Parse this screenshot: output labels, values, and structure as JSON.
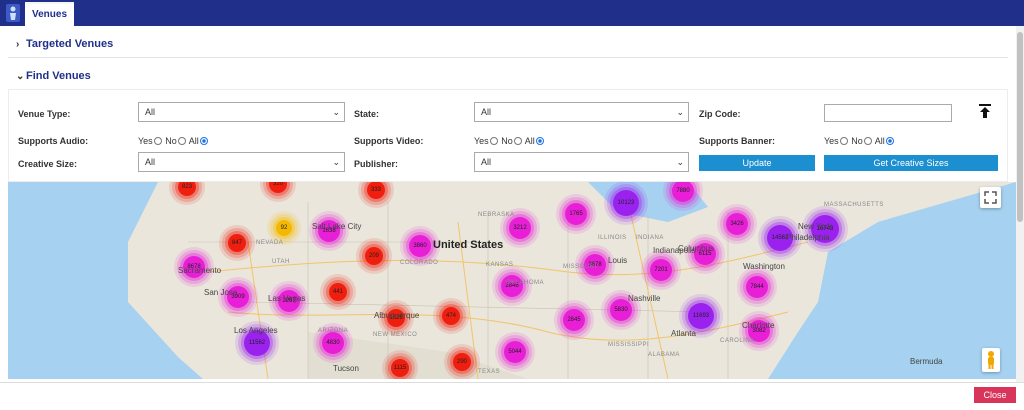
{
  "tab": {
    "label": "Venues"
  },
  "sections": {
    "targeted": "Targeted Venues",
    "find": "Find Venues"
  },
  "form": {
    "venue_type": {
      "label": "Venue Type:",
      "value": "All"
    },
    "state": {
      "label": "State:",
      "value": "All"
    },
    "zip": {
      "label": "Zip Code:",
      "value": ""
    },
    "audio": {
      "label": "Supports Audio:"
    },
    "video": {
      "label": "Supports Video:"
    },
    "banner": {
      "label": "Supports Banner:"
    },
    "radio_options": {
      "yes": "Yes",
      "no": "No",
      "all": "All"
    },
    "creative_size": {
      "label": "Creative Size:",
      "value": "All"
    },
    "publisher": {
      "label": "Publisher:",
      "value": "All"
    },
    "update_label": "Update",
    "get_sizes_label": "Get Creative Sizes"
  },
  "map": {
    "country": "United States",
    "states": [
      "NEBRASKA",
      "NEVADA",
      "UTAH",
      "COLORADO",
      "KANSAS",
      "MISSOURI",
      "ILLINOIS",
      "INDIANA",
      "OKLAHOMA",
      "NEW MEXICO",
      "ARIZONA",
      "TEXAS",
      "MISSISSIPPI",
      "ALABAMA",
      "CAROLINA",
      "MASSACHUSETTS"
    ],
    "cities": [
      "Sacramento",
      "San Jose",
      "Los Angeles",
      "Las Vegas",
      "Salt Lake City",
      "Albuquerque",
      "Tucson",
      "Nashville",
      "Atlanta",
      "Louis",
      "Indianapolis",
      "Columbus",
      "Washington",
      "New York",
      "Philadelphia",
      "Charlotte",
      "Bermuda"
    ],
    "clusters": [
      {
        "label": "823",
        "tone": "red"
      },
      {
        "label": "320",
        "tone": "red"
      },
      {
        "label": "333",
        "tone": "red"
      },
      {
        "label": "92",
        "tone": "yellow"
      },
      {
        "label": "1638",
        "tone": "magenta"
      },
      {
        "label": "847",
        "tone": "red"
      },
      {
        "label": "209",
        "tone": "red"
      },
      {
        "label": "3860",
        "tone": "magenta"
      },
      {
        "label": "1765",
        "tone": "magenta"
      },
      {
        "label": "10123",
        "tone": "purple"
      },
      {
        "label": "7880",
        "tone": "magenta"
      },
      {
        "label": "3426",
        "tone": "magenta"
      },
      {
        "label": "14563",
        "tone": "purple"
      },
      {
        "label": "16743",
        "tone": "purple"
      },
      {
        "label": "8678",
        "tone": "magenta"
      },
      {
        "label": "3212",
        "tone": "magenta"
      },
      {
        "label": "3678",
        "tone": "magenta"
      },
      {
        "label": "7201",
        "tone": "magenta"
      },
      {
        "label": "6115",
        "tone": "magenta"
      },
      {
        "label": "3909",
        "tone": "magenta"
      },
      {
        "label": "2267",
        "tone": "magenta"
      },
      {
        "label": "441",
        "tone": "red"
      },
      {
        "label": "2846",
        "tone": "magenta"
      },
      {
        "label": "7844",
        "tone": "magenta"
      },
      {
        "label": "1626",
        "tone": "red"
      },
      {
        "label": "474",
        "tone": "red"
      },
      {
        "label": "2845",
        "tone": "magenta"
      },
      {
        "label": "5830",
        "tone": "magenta"
      },
      {
        "label": "11693",
        "tone": "purple"
      },
      {
        "label": "3082",
        "tone": "magenta"
      },
      {
        "label": "11562",
        "tone": "purple"
      },
      {
        "label": "4830",
        "tone": "magenta"
      },
      {
        "label": "290",
        "tone": "red"
      },
      {
        "label": "5044",
        "tone": "magenta"
      },
      {
        "label": "1115",
        "tone": "red"
      }
    ]
  },
  "footer": {
    "close_label": "Close"
  },
  "colors": {
    "navbar": "#1f2f8a",
    "primary_button": "#1c8fd1",
    "close_button": "#d9355a",
    "cluster_red": "#f01e0e",
    "cluster_magenta": "#e81fd6",
    "cluster_purple": "#9b22ee",
    "cluster_yellow": "#f5b800"
  }
}
